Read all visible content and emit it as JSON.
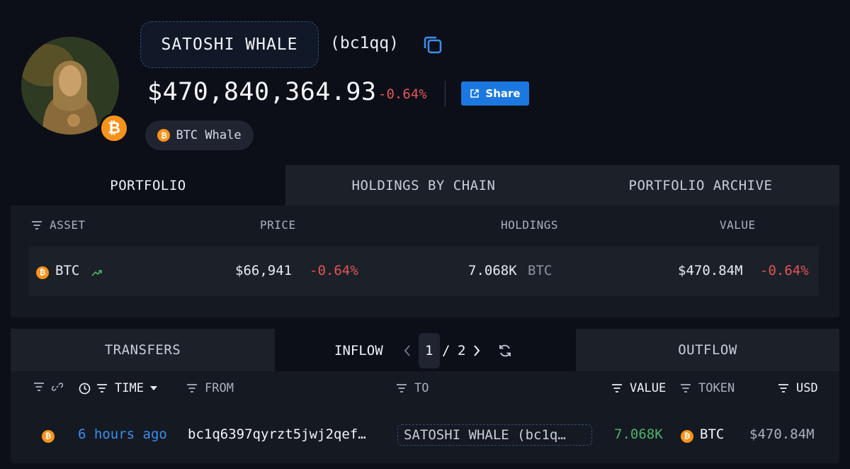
{
  "header": {
    "entity_name": "SATOSHI WHALE",
    "address_short": "(bc1qq)",
    "balance": "$470,840,364.93",
    "balance_change": "-0.64%",
    "share_label": "Share",
    "tag_label": "BTC Whale",
    "avatar_badge": "₿"
  },
  "portfolio": {
    "tabs": [
      "PORTFOLIO",
      "HOLDINGS BY CHAIN",
      "PORTFOLIO ARCHIVE"
    ],
    "columns": {
      "asset": "ASSET",
      "price": "PRICE",
      "holdings": "HOLDINGS",
      "value": "VALUE"
    },
    "rows": [
      {
        "asset": "BTC",
        "price": "$66,941",
        "price_change": "-0.64%",
        "holdings": "7.068K",
        "holdings_unit": "BTC",
        "value": "$470.84M",
        "value_change": "-0.64%"
      }
    ]
  },
  "transfers": {
    "tabs": {
      "transfers": "TRANSFERS",
      "inflow": "INFLOW",
      "outflow": "OUTFLOW"
    },
    "pagination": {
      "current": "1",
      "separator": "/",
      "total": "2"
    },
    "columns": {
      "time": "TIME",
      "from": "FROM",
      "to": "TO",
      "value": "VALUE",
      "token": "TOKEN",
      "usd": "USD"
    },
    "rows": [
      {
        "time": "6 hours ago",
        "from": "bc1q6397qyrzt5jwj2qef…",
        "to": "SATOSHI WHALE (bc1q…",
        "value": "7.068K",
        "token": "BTC",
        "usd": "$470.84M"
      }
    ]
  },
  "colors": {
    "background": "#0c0f18",
    "accent_blue": "#1b78e0",
    "negative": "#e05656",
    "positive": "#4fb36a",
    "btc_orange": "#f7931a"
  }
}
